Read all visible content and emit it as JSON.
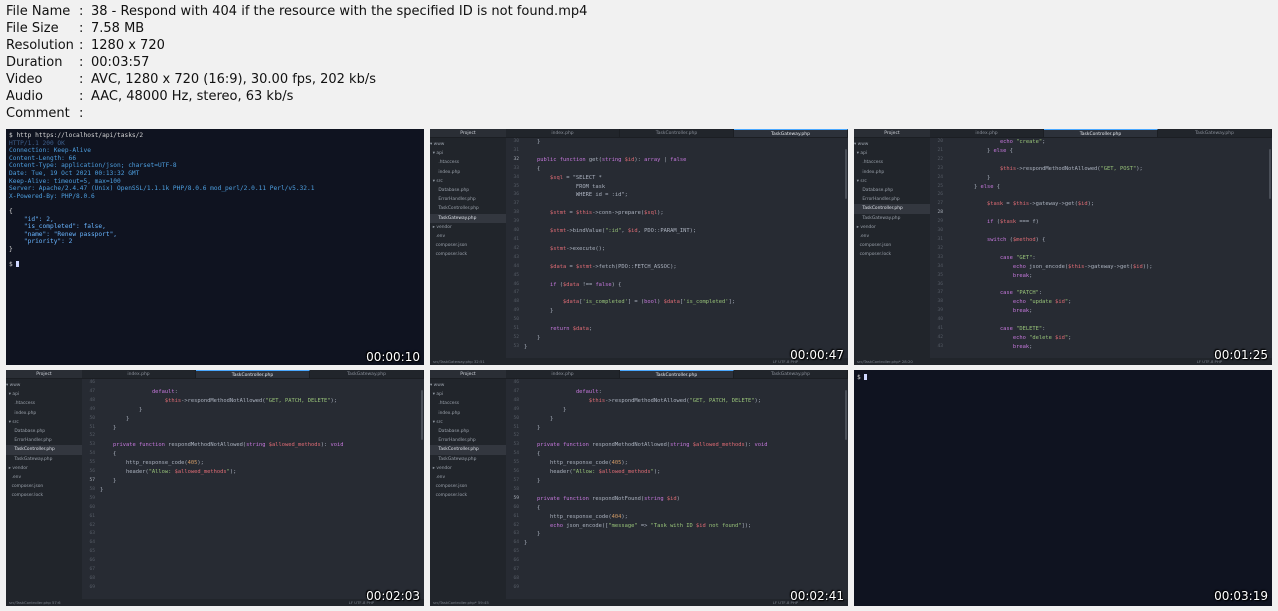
{
  "info": {
    "rows": [
      {
        "key": "File Name",
        "value": "38 - Respond with 404 if the resource with the specified ID is not found.mp4"
      },
      {
        "key": "File Size",
        "value": "7.58 MB"
      },
      {
        "key": "Resolution",
        "value": "1280 x 720"
      },
      {
        "key": "Duration",
        "value": "00:03:57"
      },
      {
        "key": "Video",
        "value": "AVC, 1280 x 720 (16:9), 30.00 fps, 202 kb/s"
      },
      {
        "key": "Audio",
        "value": "AAC, 48000 Hz, stereo, 63 kb/s"
      },
      {
        "key": "Comment",
        "value": ""
      }
    ],
    "separator": ":"
  },
  "thumbs": [
    {
      "timestamp": "00:00:10",
      "terminal": {
        "lines": [
          "$ http https://localhost/api/tasks/2",
          "HTTP/1.1 200 OK",
          "Connection: Keep-Alive",
          "Content-Length: 66",
          "Content-Type: application/json; charset=UTF-8",
          "Date: Tue, 19 Oct 2021 00:13:32 GMT",
          "Keep-Alive: timeout=5, max=100",
          "Server: Apache/2.4.47 (Unix) OpenSSL/1.1.1k PHP/8.0.6 mod_perl/2.0.11 Perl/v5.32.1",
          "X-Powered-By: PHP/8.0.6",
          "",
          "{",
          "    \"id\": 2,",
          "    \"is_completed\": false,",
          "    \"name\": \"Renew passport\",",
          "    \"priority\": 2",
          "}",
          "",
          "$"
        ]
      }
    },
    {
      "timestamp": "00:00:47",
      "tabs": [
        "Project",
        "index.php",
        "TaskController.php",
        "TaskGateway.php"
      ],
      "active_tab": 3,
      "tree": [
        "▾ www",
        "  ▾ api",
        "      .htaccess",
        "      index.php",
        "  ▾ src",
        "      Database.php",
        "      ErrorHandler.php",
        "      TaskController.php",
        "      TaskGateway.php",
        "  ▸ vendor",
        "    .env",
        "    composer.json",
        "    composer.lock"
      ],
      "tree_sel": 8,
      "gutter_start": 30,
      "cur_line": 32,
      "code": [
        "    }",
        "",
        "    public function get(string $id): array | false",
        "    {",
        "        $sql = \"SELECT *",
        "                FROM task",
        "                WHERE id = :id\";",
        "",
        "        $stmt = $this->conn->prepare($sql);",
        "",
        "        $stmt->bindValue(\":id\", $id, PDO::PARAM_INT);",
        "",
        "        $stmt->execute();",
        "",
        "        $data = $stmt->fetch(PDO::FETCH_ASSOC);",
        "",
        "        if ($data !== false) {",
        "",
        "            $data['is_completed'] = (bool) $data['is_completed'];",
        "        }",
        "",
        "        return $data;",
        "    }",
        "}"
      ],
      "status_left": "src/TaskGateway.php   32:51",
      "status_right": "LF   UTF-8   PHP"
    },
    {
      "timestamp": "00:01:25",
      "tabs": [
        "Project",
        "index.php",
        "TaskController.php",
        "TaskGateway.php"
      ],
      "active_tab": 2,
      "tree": [
        "▾ www",
        "  ▾ api",
        "      .htaccess",
        "      index.php",
        "  ▾ src",
        "      Database.php",
        "      ErrorHandler.php",
        "      TaskController.php",
        "      TaskGateway.php",
        "  ▸ vendor",
        "    .env",
        "    composer.json",
        "    composer.lock"
      ],
      "tree_sel": 7,
      "gutter_start": 20,
      "cur_line": 28,
      "code": [
        "                echo \"create\";",
        "            } else {",
        "",
        "                $this->respondMethodNotAllowed(\"GET, POST\");",
        "            }",
        "        } else {",
        "",
        "            $task = $this->gateway->get($id);",
        "",
        "            if ($task === f)",
        "",
        "            switch ($method) {",
        "",
        "                case \"GET\":",
        "                    echo json_encode($this->gateway->get($id));",
        "                    break;",
        "",
        "                case \"PATCH\":",
        "                    echo \"update $id\";",
        "                    break;",
        "",
        "                case \"DELETE\":",
        "                    echo \"delete $id\";",
        "                    break;"
      ],
      "status_left": "src/TaskController.php*   28:20",
      "status_right": "LF   UTF-8   PHP"
    },
    {
      "timestamp": "00:02:03",
      "tabs": [
        "Project",
        "index.php",
        "TaskController.php",
        "TaskGateway.php"
      ],
      "active_tab": 2,
      "tree": [
        "▾ www",
        "  ▾ api",
        "      .htaccess",
        "      index.php",
        "  ▾ src",
        "      Database.php",
        "      ErrorHandler.php",
        "      TaskController.php",
        "      TaskGateway.php",
        "  ▸ vendor",
        "    .env",
        "    composer.json",
        "    composer.lock"
      ],
      "tree_sel": 7,
      "gutter_start": 46,
      "cur_line": 57,
      "code": [
        "",
        "                default:",
        "                    $this->respondMethodNotAllowed(\"GET, PATCH, DELETE\");",
        "            }",
        "        }",
        "    }",
        "",
        "    private function respondMethodNotAllowed(string $allowed_methods): void",
        "    {",
        "        http_response_code(405);",
        "        header(\"Allow: $allowed_methods\");",
        "    }",
        "}",
        "",
        "",
        "",
        "",
        "",
        "",
        "",
        "",
        "",
        "",
        ""
      ],
      "status_left": "src/TaskController.php   57:6",
      "status_right": "LF   UTF-8   PHP"
    },
    {
      "timestamp": "00:02:41",
      "tabs": [
        "Project",
        "index.php",
        "TaskController.php",
        "TaskGateway.php"
      ],
      "active_tab": 2,
      "tree": [
        "▾ www",
        "  ▾ api",
        "      .htaccess",
        "      index.php",
        "  ▾ src",
        "      Database.php",
        "      ErrorHandler.php",
        "      TaskController.php",
        "      TaskGateway.php",
        "  ▸ vendor",
        "    .env",
        "    composer.json",
        "    composer.lock"
      ],
      "tree_sel": 7,
      "gutter_start": 46,
      "cur_line": 59,
      "code": [
        "",
        "                default:",
        "                    $this->respondMethodNotAllowed(\"GET, PATCH, DELETE\");",
        "            }",
        "        }",
        "    }",
        "",
        "    private function respondMethodNotAllowed(string $allowed_methods): void",
        "    {",
        "        http_response_code(405);",
        "        header(\"Allow: $allowed_methods\");",
        "    }",
        "",
        "    private function respondNotFound(string $id)",
        "    {",
        "        http_response_code(404);",
        "        echo json_encode([\"message\" => \"Task with ID $id not found\"]);",
        "    }",
        "}",
        "",
        "",
        "",
        "",
        ""
      ],
      "status_left": "src/TaskController.php*   59:45",
      "status_right": "LF   UTF-8   PHP"
    },
    {
      "timestamp": "00:03:19",
      "prompt": "$"
    }
  ]
}
